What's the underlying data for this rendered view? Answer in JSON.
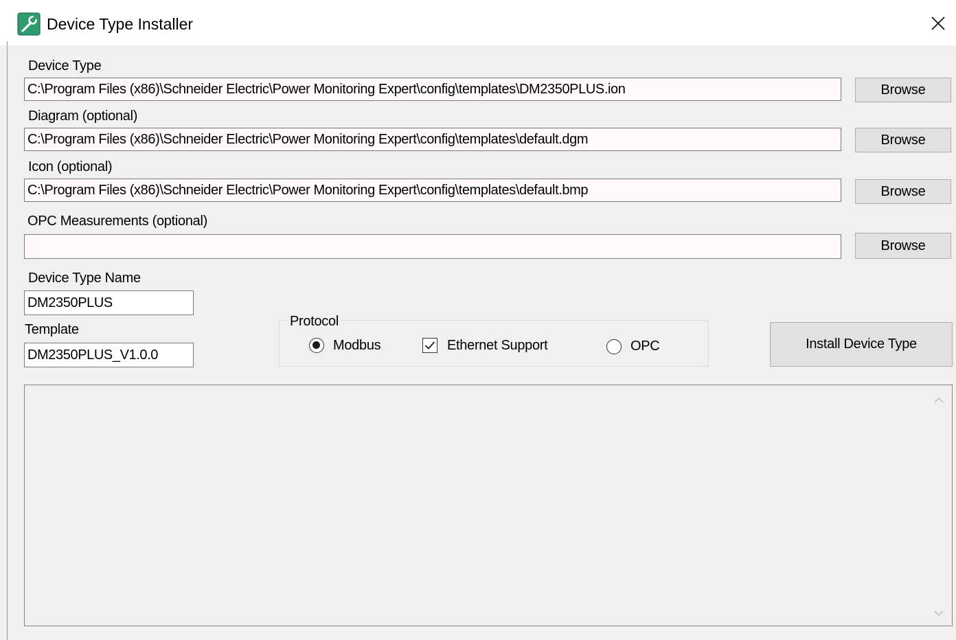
{
  "window": {
    "title": "Device Type Installer",
    "icon": "wrench-icon",
    "close_icon": "close-icon"
  },
  "fields": {
    "device_type": {
      "label": "Device Type",
      "value": "C:\\Program Files (x86)\\Schneider Electric\\Power Monitoring Expert\\config\\templates\\DM2350PLUS.ion",
      "browse_label": "Browse"
    },
    "diagram": {
      "label": "Diagram (optional)",
      "value": "C:\\Program Files (x86)\\Schneider Electric\\Power Monitoring Expert\\config\\templates\\default.dgm",
      "browse_label": "Browse"
    },
    "icon": {
      "label": "Icon (optional)",
      "value": "C:\\Program Files (x86)\\Schneider Electric\\Power Monitoring Expert\\config\\templates\\default.bmp",
      "browse_label": "Browse"
    },
    "opc_measurements": {
      "label": "OPC Measurements (optional)",
      "value": "",
      "browse_label": "Browse"
    },
    "device_type_name": {
      "label": "Device Type Name",
      "value": "DM2350PLUS"
    },
    "template": {
      "label": "Template",
      "value": "DM2350PLUS_V1.0.0"
    }
  },
  "protocol": {
    "title": "Protocol",
    "options": [
      {
        "label": "Modbus",
        "selected": true
      },
      {
        "label": "OPC",
        "selected": false
      }
    ],
    "ethernet_support": {
      "label": "Ethernet Support",
      "checked": true
    }
  },
  "actions": {
    "install_label": "Install Device Type"
  },
  "log": {
    "text": ""
  },
  "colors": {
    "icon_green": "#2e9c6e",
    "field_background": "#fffaf9",
    "window_background": "#f0f0f0"
  }
}
